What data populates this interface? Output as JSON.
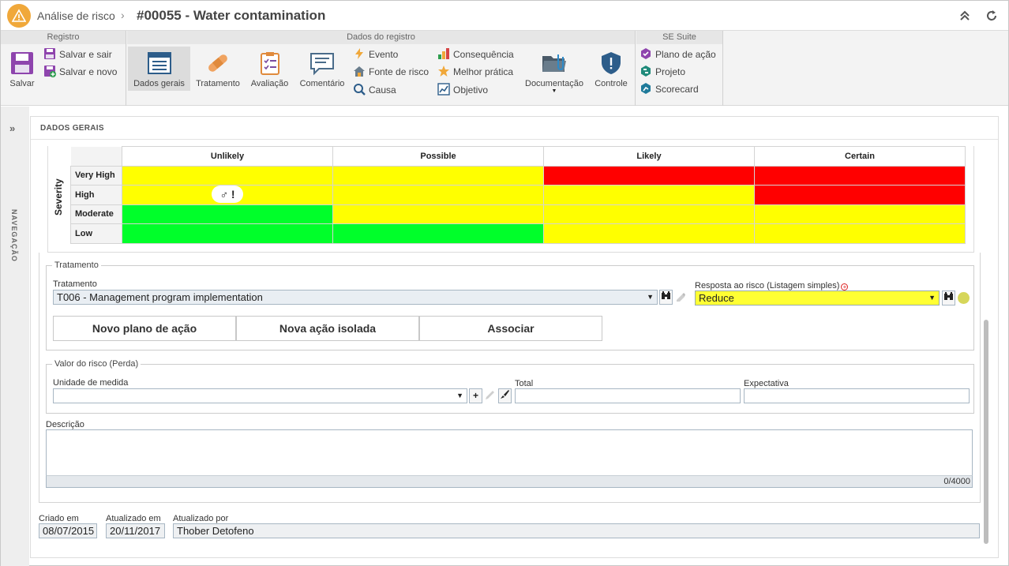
{
  "header": {
    "breadcrumb": "Análise de risco",
    "separator": "›",
    "title": "#00055 - Water contamination"
  },
  "ribbon": {
    "groups": {
      "registro": "Registro",
      "dados": "Dados do registro",
      "suite": "SE Suite"
    },
    "salvar": "Salvar",
    "salvar_e_sair": "Salvar e sair",
    "salvar_e_novo": "Salvar e novo",
    "dados_gerais": "Dados gerais",
    "tratamento": "Tratamento",
    "avaliacao": "Avaliação",
    "comentario": "Comentário",
    "evento": "Evento",
    "fonte_de_risco": "Fonte de risco",
    "causa": "Causa",
    "consequencia": "Consequência",
    "melhor_pratica": "Melhor prática",
    "objetivo": "Objetivo",
    "documentacao": "Documentação",
    "controle": "Controle",
    "plano_de_acao": "Plano de ação",
    "projeto": "Projeto",
    "scorecard": "Scorecard"
  },
  "nav": {
    "label": "NAVEGAÇÃO"
  },
  "panel": {
    "title": "DADOS GERAIS"
  },
  "matrix": {
    "axis_label": "Severity",
    "columns": [
      "Unlikely",
      "Possible",
      "Likely",
      "Certain"
    ],
    "rows": [
      {
        "label": "Very High",
        "colors": [
          "yellow",
          "yellow",
          "red",
          "red"
        ]
      },
      {
        "label": "High",
        "colors": [
          "yellow",
          "yellow",
          "yellow",
          "red"
        ]
      },
      {
        "label": "Moderate",
        "colors": [
          "green",
          "yellow",
          "yellow",
          "yellow"
        ]
      },
      {
        "label": "Low",
        "colors": [
          "green",
          "green",
          "yellow",
          "yellow"
        ]
      }
    ],
    "marker_text": "♂ !",
    "marker_row": "High",
    "marker_col": "Unlikely"
  },
  "tratamento": {
    "legend": "Tratamento",
    "field_label": "Tratamento",
    "value": "T006 - Management program implementation",
    "resposta_label": "Resposta ao risco (Listagem simples)",
    "resposta_value": "Reduce",
    "resposta_color": "#ffff33",
    "btn_novo_plano": "Novo plano de ação",
    "btn_nova_acao": "Nova ação isolada",
    "btn_associar": "Associar"
  },
  "valor": {
    "legend": "Valor do risco (Perda)",
    "unidade_label": "Unidade de medida",
    "unidade_value": "",
    "total_label": "Total",
    "total_value": "",
    "expectativa_label": "Expectativa",
    "expectativa_value": ""
  },
  "descricao": {
    "label": "Descrição",
    "value": "",
    "counter": "0/4000"
  },
  "footer": {
    "criado_label": "Criado em",
    "criado_value": "08/07/2015",
    "atualizado_label": "Atualizado em",
    "atualizado_value": "20/11/2017",
    "atualizado_por_label": "Atualizado por",
    "atualizado_por_value": "Thober Detofeno"
  }
}
